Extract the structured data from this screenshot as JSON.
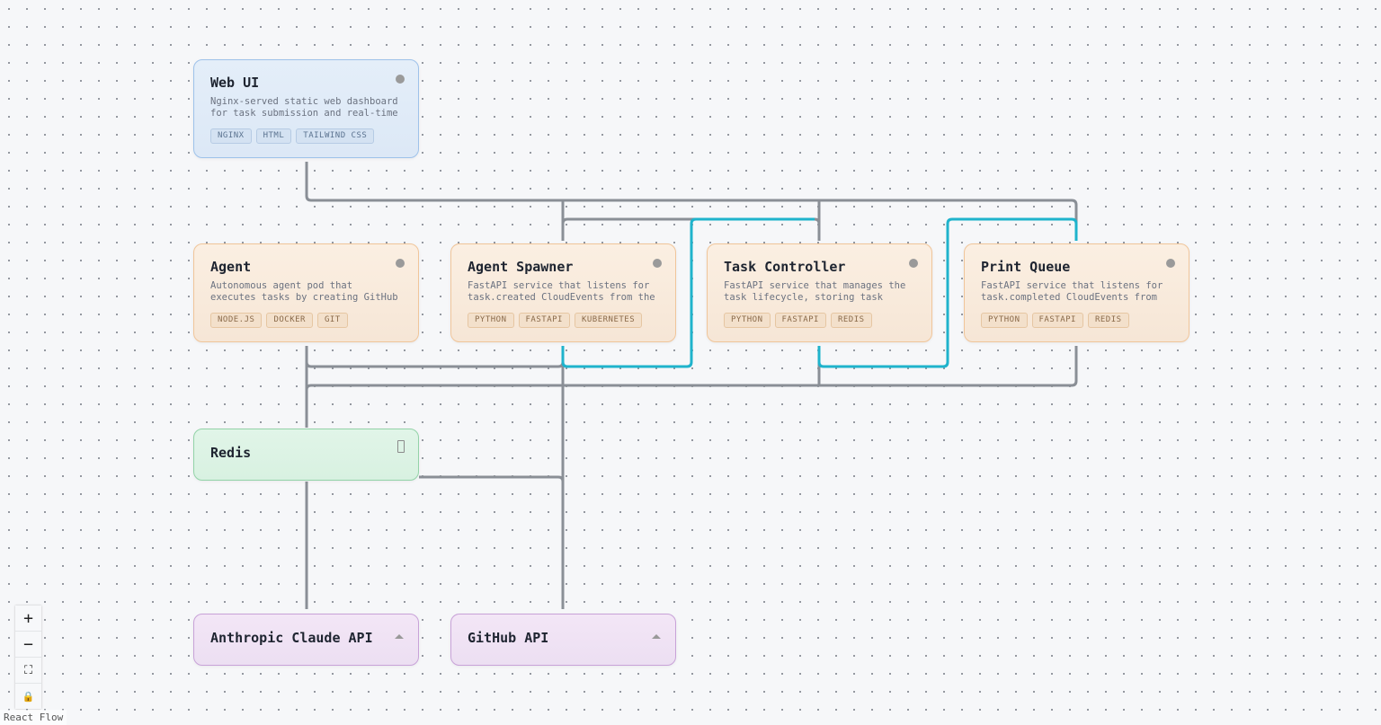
{
  "nodes": {
    "web_ui": {
      "title": "Web UI",
      "description": "Nginx-served static web dashboard for task submission and real-time",
      "tags": [
        "NGINX",
        "HTML",
        "TAILWIND CSS"
      ]
    },
    "agent": {
      "title": "Agent",
      "description": "Autonomous agent pod that executes tasks by creating GitHub",
      "tags": [
        "NODE.JS",
        "DOCKER",
        "GIT"
      ]
    },
    "agent_spawner": {
      "title": "Agent Spawner",
      "description": "FastAPI service that listens for task.created CloudEvents from the",
      "tags": [
        "PYTHON",
        "FASTAPI",
        "KUBERNETES"
      ]
    },
    "task_controller": {
      "title": "Task Controller",
      "description": "FastAPI service that manages the task lifecycle, storing task state",
      "tags": [
        "PYTHON",
        "FASTAPI",
        "REDIS"
      ]
    },
    "print_queue": {
      "title": "Print Queue",
      "description": "FastAPI service that listens for task.completed CloudEvents from",
      "tags": [
        "PYTHON",
        "FASTAPI",
        "REDIS"
      ]
    },
    "redis": {
      "title": "Redis"
    },
    "claude_api": {
      "title": "Anthropic Claude API"
    },
    "github_api": {
      "title": "GitHub API"
    }
  },
  "colors": {
    "edge_default": "#8a8f96",
    "edge_highlight": "#1fb3cc"
  },
  "controls": {
    "zoom_in": "+",
    "zoom_out": "−",
    "fit_view": "⛶",
    "lock": "🔒"
  },
  "attribution": "React Flow"
}
